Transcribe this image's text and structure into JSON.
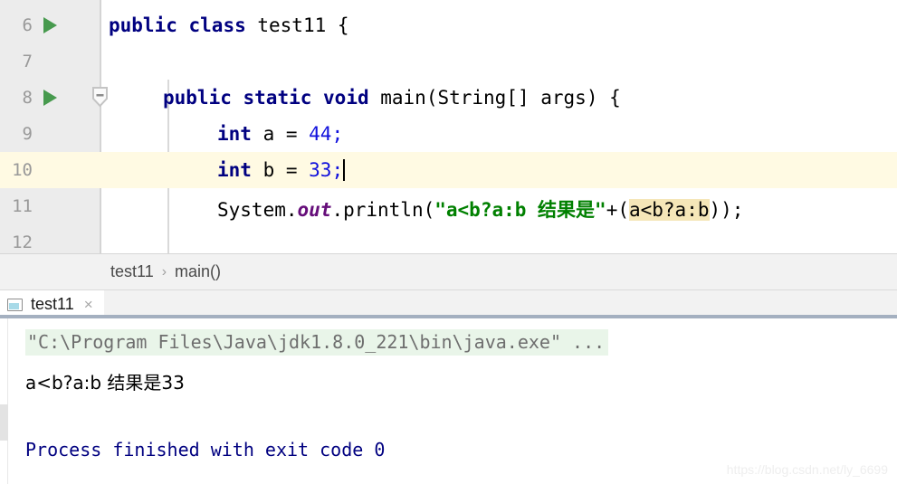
{
  "editor": {
    "lines": [
      {
        "number": "6",
        "has_run_arrow": true,
        "has_fold": false,
        "current": false,
        "text": "public class test11 {"
      },
      {
        "number": "7",
        "has_run_arrow": false,
        "has_fold": false,
        "current": false,
        "text": ""
      },
      {
        "number": "8",
        "has_run_arrow": true,
        "has_fold": true,
        "current": false,
        "text": "    public static void main(String[] args) {"
      },
      {
        "number": "9",
        "has_run_arrow": false,
        "has_fold": false,
        "current": false,
        "text": "        int a = 44;"
      },
      {
        "number": "10",
        "has_run_arrow": false,
        "has_fold": false,
        "current": true,
        "text": "        int b = 33;"
      },
      {
        "number": "11",
        "has_run_arrow": false,
        "has_fold": false,
        "current": false,
        "text": "        System.out.println(\"a<b?a:b 结果是\"+(a<b?a:b));"
      },
      {
        "number": "12",
        "has_run_arrow": false,
        "has_fold": false,
        "current": false,
        "text": ""
      }
    ],
    "tokens": {
      "kw_public": "public",
      "kw_class": "class",
      "kw_static": "static",
      "kw_void": "void",
      "kw_int": "int",
      "ident_test11": " test11 {",
      "main_sig": " main(String[] args) {",
      "var_a": " a = ",
      "var_b": " b = ",
      "num_44": "44",
      "num_33": "33",
      "semi": ";",
      "sysout_pre": "System.",
      "sysout_field": "out",
      "sysout_call": ".println(",
      "string_literal": "\"a<b?a:b 结果是\"",
      "concat": "+(",
      "ternary": "a<b?a:b",
      "tail": "));"
    },
    "colors": {
      "keyword": "#000080",
      "number": "#1111dd",
      "string": "#008000",
      "static_field": "#660e7a",
      "search_highlight": "#f5e6b8",
      "current_line": "#fffae3",
      "gutter": "#ececec",
      "run_arrow": "#479a4e"
    }
  },
  "breadcrumb": {
    "items": [
      "test11",
      "main()"
    ],
    "separator": "›"
  },
  "run_window": {
    "tab": {
      "icon": "console-icon",
      "label": "test11",
      "close": "×"
    },
    "console": {
      "command_line": "\"C:\\Program Files\\Java\\jdk1.8.0_221\\bin\\java.exe\" ...",
      "program_output": "a<b?a:b 结果是33",
      "blank_line": "",
      "exit_line": "Process finished with exit code 0"
    }
  },
  "watermark": {
    "text": "https://blog.csdn.net/ly_6699"
  }
}
